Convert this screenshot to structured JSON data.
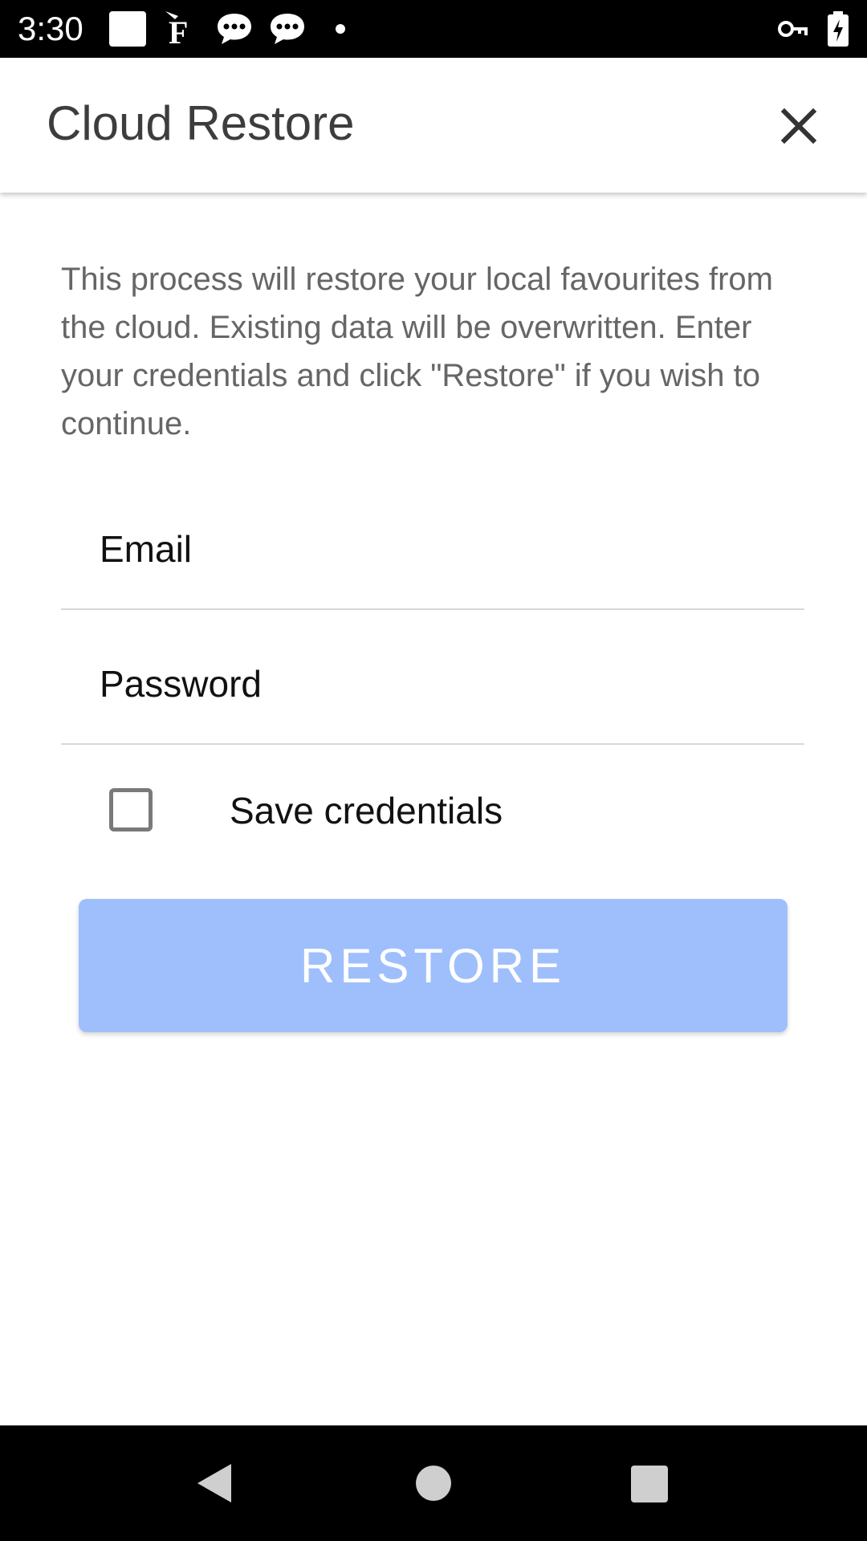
{
  "status_bar": {
    "time": "3:30",
    "icons": [
      "notification-square-icon",
      "f-app-icon",
      "chat-bubble-icon",
      "chat-bubble-icon",
      "dot-icon",
      "vpn-key-icon",
      "battery-charging-icon"
    ]
  },
  "toolbar": {
    "title": "Cloud Restore",
    "close_icon": "close-icon"
  },
  "content": {
    "description": "This process will restore your local favourites from the cloud. Existing data will be overwritten. Enter your credentials and click \"Restore\" if you wish to continue.",
    "email": {
      "placeholder": "Email",
      "value": ""
    },
    "password": {
      "placeholder": "Password",
      "value": ""
    },
    "save_credentials": {
      "label": "Save credentials",
      "checked": false
    },
    "restore_button": "RESTORE"
  },
  "colors": {
    "button_bg": "#9fbffc",
    "title_text": "#3d3d3d",
    "body_text": "#666666"
  },
  "nav_bar": {
    "icons": [
      "back-icon",
      "home-icon",
      "recents-icon"
    ]
  }
}
